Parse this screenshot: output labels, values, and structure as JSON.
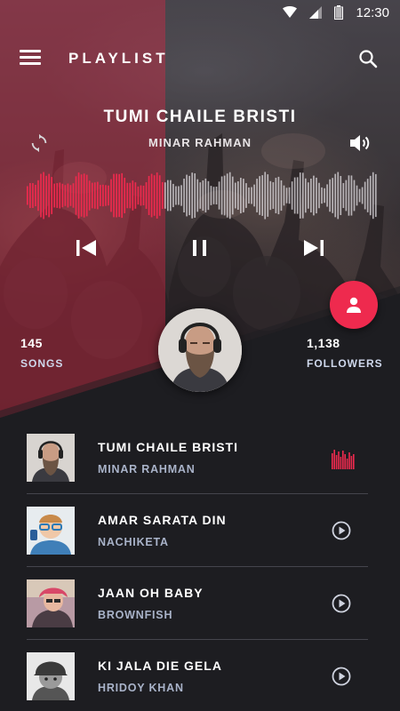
{
  "status_bar": {
    "time": "12:30"
  },
  "app_bar": {
    "title": "PLAYLIST"
  },
  "now_playing": {
    "title": "TUMI CHAILE BRISTI",
    "artist": "MINAR RAHMAN",
    "progress": 0.39
  },
  "stats": {
    "songs_count": "145",
    "songs_label": "SONGS",
    "followers_count": "1,138",
    "followers_label": "FOLLOWERS"
  },
  "colors": {
    "accent": "#ee2a4e",
    "background": "#1d1d21",
    "secondary_text": "#a9b3c9"
  },
  "tracks": [
    {
      "title": "TUMI CHAILE BRISTI",
      "artist": "MINAR RAHMAN",
      "status_icon": "equalizer-icon"
    },
    {
      "title": "AMAR SARATA DIN",
      "artist": "NACHIKETA",
      "status_icon": "play-circle-icon"
    },
    {
      "title": "JAAN OH BABY",
      "artist": "BROWNFISH",
      "status_icon": "play-circle-icon"
    },
    {
      "title": "KI JALA DIE GELA",
      "artist": "HRIDOY KHAN",
      "status_icon": "play-circle-icon"
    }
  ]
}
